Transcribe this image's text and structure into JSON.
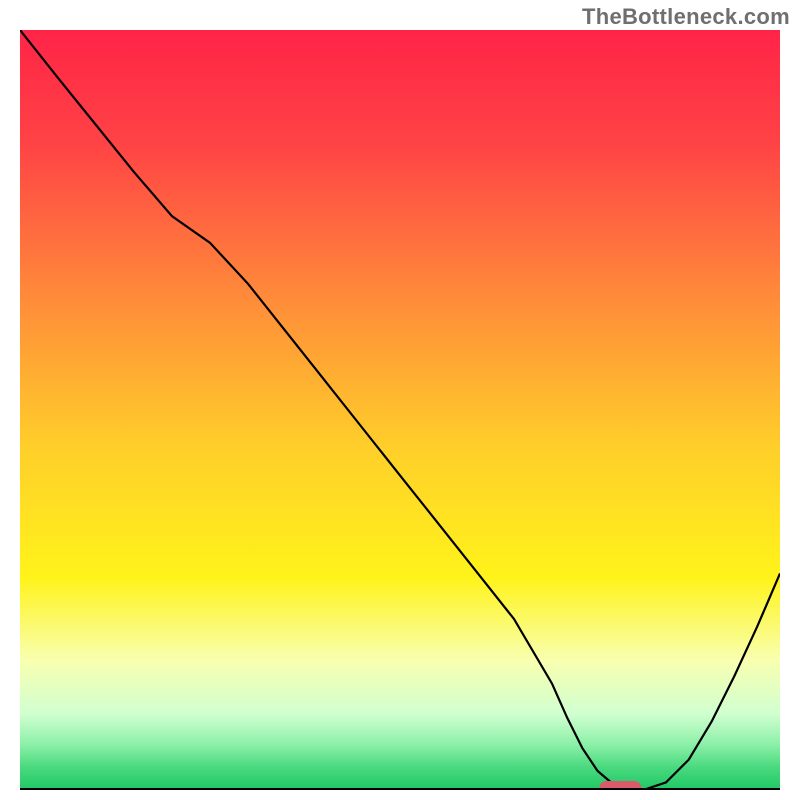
{
  "watermark": "TheBottleneck.com",
  "chart_data": {
    "type": "line",
    "x": [
      0.0,
      0.05,
      0.1,
      0.15,
      0.2,
      0.25,
      0.3,
      0.35,
      0.4,
      0.45,
      0.5,
      0.55,
      0.6,
      0.65,
      0.7,
      0.72,
      0.74,
      0.76,
      0.78,
      0.8,
      0.82,
      0.85,
      0.88,
      0.91,
      0.94,
      0.97,
      1.0
    ],
    "values": [
      1.0,
      0.937,
      0.875,
      0.813,
      0.755,
      0.72,
      0.666,
      0.603,
      0.54,
      0.477,
      0.414,
      0.351,
      0.288,
      0.225,
      0.14,
      0.095,
      0.055,
      0.025,
      0.008,
      0.0,
      0.0,
      0.01,
      0.04,
      0.09,
      0.15,
      0.215,
      0.285
    ],
    "title": "",
    "xlabel": "",
    "ylabel": "",
    "xlim": [
      0,
      1
    ],
    "ylim": [
      0,
      1
    ],
    "grid": false,
    "marker": {
      "x": 0.79,
      "y": 0.0,
      "color": "#d95a6a"
    },
    "background_gradient": {
      "stops": [
        {
          "offset": 0.0,
          "color": "#ff2447"
        },
        {
          "offset": 0.15,
          "color": "#ff4345"
        },
        {
          "offset": 0.35,
          "color": "#ff8a3a"
        },
        {
          "offset": 0.55,
          "color": "#ffcf2a"
        },
        {
          "offset": 0.72,
          "color": "#fff31a"
        },
        {
          "offset": 0.83,
          "color": "#f8ffb0"
        },
        {
          "offset": 0.9,
          "color": "#d0ffd0"
        },
        {
          "offset": 0.94,
          "color": "#8cf0a8"
        },
        {
          "offset": 0.97,
          "color": "#4ad97f"
        },
        {
          "offset": 1.0,
          "color": "#1fc763"
        }
      ]
    }
  }
}
